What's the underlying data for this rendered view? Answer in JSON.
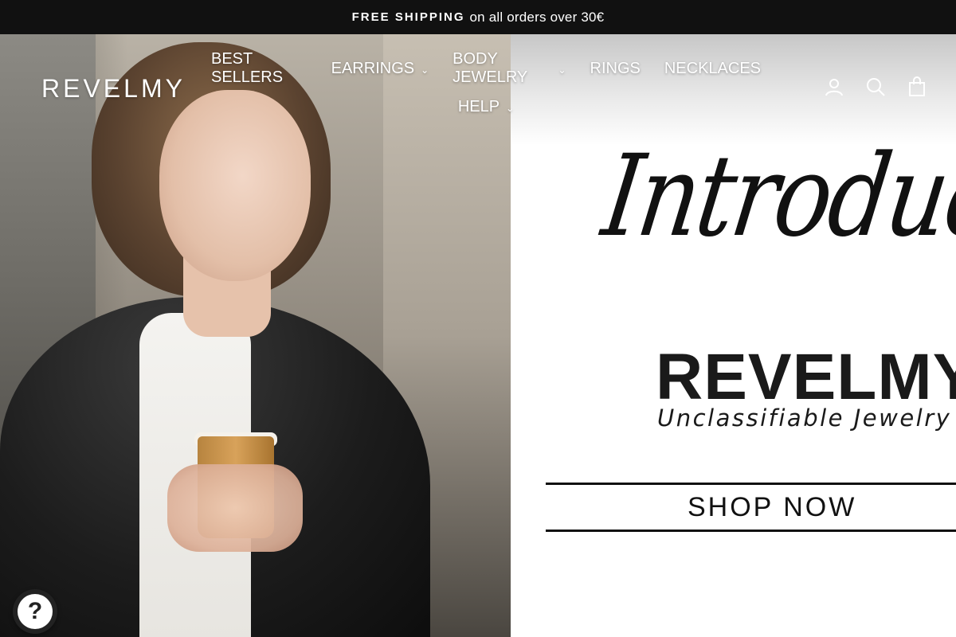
{
  "announcement": {
    "bold": "FREE SHIPPING",
    "text": "on all orders over 30€"
  },
  "header": {
    "logo": "REVELMY",
    "nav": [
      {
        "label": "BEST SELLERS",
        "has_dropdown": false
      },
      {
        "label": "EARRINGS",
        "has_dropdown": true
      },
      {
        "label": "BODY JEWELRY",
        "has_dropdown": true
      },
      {
        "label": "RINGS",
        "has_dropdown": false
      },
      {
        "label": "NECKLACES",
        "has_dropdown": false
      },
      {
        "label": "HELP",
        "has_dropdown": true
      }
    ],
    "icons": [
      "account-icon",
      "search-icon",
      "cart-icon"
    ]
  },
  "hero": {
    "script_text": "Introducing",
    "brand": "REVELMY",
    "tagline": "Unclassifiable Jewelry",
    "cta": "SHOP NOW"
  },
  "help_widget": {
    "symbol": "?"
  },
  "colors": {
    "announcement_bg": "#111111",
    "text_dark": "#111111",
    "nav_text": "#ffffff"
  }
}
